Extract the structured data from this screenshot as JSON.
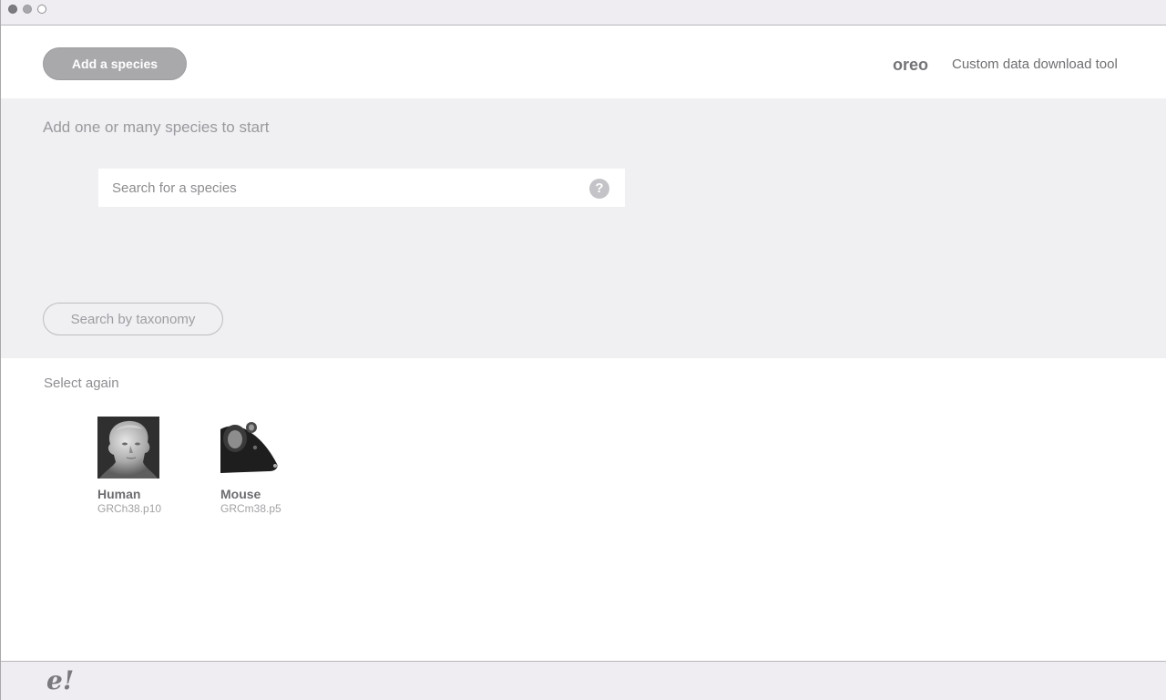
{
  "header": {
    "add_species_label": "Add a species",
    "brand": "oreo",
    "tool_title": "Custom data download tool"
  },
  "panel": {
    "heading": "Add one or many species to start",
    "search_placeholder": "Search for a species",
    "help_glyph": "?",
    "taxonomy_label": "Search by taxonomy"
  },
  "recent": {
    "heading": "Select again",
    "species": [
      {
        "name": "Human",
        "assembly": "GRCh38.p10",
        "icon": "human-bust-thumbnail"
      },
      {
        "name": "Mouse",
        "assembly": "GRCm38.p5",
        "icon": "mouse-thumbnail"
      }
    ]
  },
  "footer": {
    "logo": "e!"
  },
  "colors": {
    "panel_bg": "#f0eff2",
    "button_bg": "#a9a8ab",
    "text_muted": "#9a999d"
  }
}
